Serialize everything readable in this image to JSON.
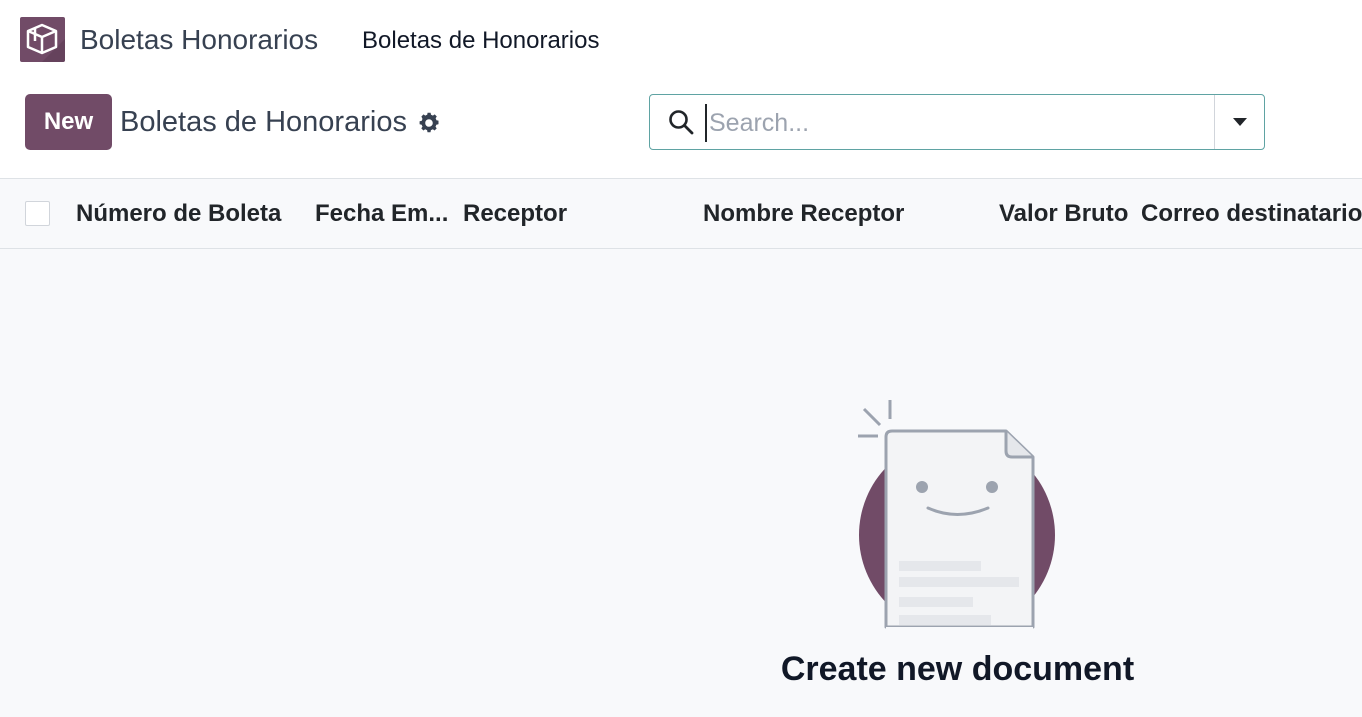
{
  "navbar": {
    "app_icon": "box-icon",
    "app_name": "Boletas Honorarios",
    "menu_item": "Boletas de Honorarios"
  },
  "control_panel": {
    "new_label": "New",
    "breadcrumb": "Boletas de Honorarios",
    "settings_icon": "gear-icon"
  },
  "search": {
    "placeholder": "Search...",
    "value": "",
    "toggle_icon": "caret-down-icon"
  },
  "table": {
    "columns": [
      "Número de Boleta",
      "Fecha Em...",
      "Receptor",
      "Nombre Receptor",
      "Valor Bruto",
      "Correo destinatario"
    ],
    "rows": []
  },
  "empty_state": {
    "title": "Create new document",
    "illustration_icon": "smiling-document-icon"
  },
  "colors": {
    "brand": "#714B67",
    "search_border": "#5fa3a3",
    "list_background": "#f8f9fb"
  }
}
